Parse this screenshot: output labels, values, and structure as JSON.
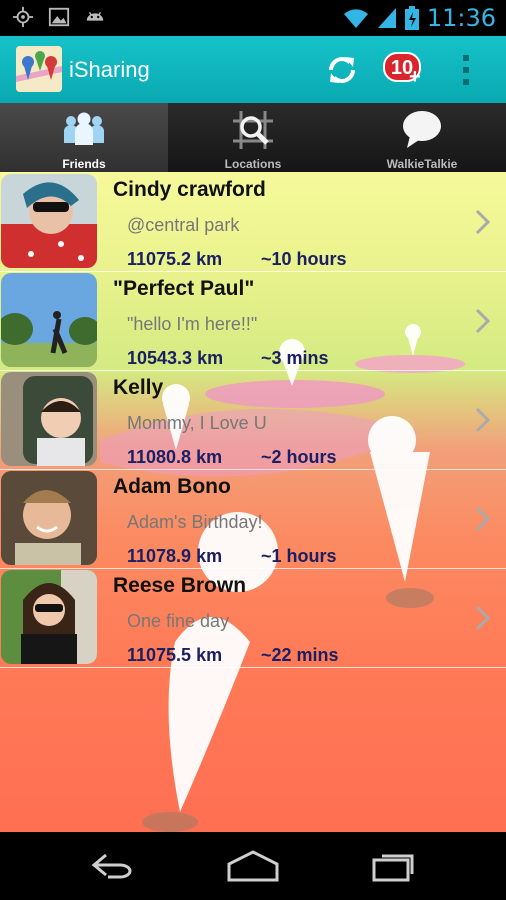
{
  "status_bar": {
    "time": "11:36",
    "icons": [
      "gps-icon",
      "image-icon",
      "android-icon",
      "wifi-icon",
      "signal-icon",
      "battery-icon"
    ]
  },
  "app_bar": {
    "title": "iSharing",
    "notification_count": "10",
    "notification_plus": "+",
    "icons": [
      "app-logo-icon",
      "refresh-icon",
      "overflow-menu-icon"
    ]
  },
  "tabs": [
    {
      "label": "Friends",
      "icon": "friends-icon",
      "active": true
    },
    {
      "label": "Locations",
      "icon": "locations-icon",
      "active": false
    },
    {
      "label": "WalkieTalkie",
      "icon": "chat-bubble-icon",
      "active": false
    }
  ],
  "friends": [
    {
      "name": "Cindy crawford",
      "status": "@central park",
      "distance": "11075.2 km",
      "time": "~10 hours"
    },
    {
      "name": "\"Perfect Paul\"",
      "status": "\"hello I'm here!!\"",
      "distance": "10543.3 km",
      "time": "~3 mins"
    },
    {
      "name": "Kelly",
      "status": "Mommy, I Love U",
      "distance": "11080.8 km",
      "time": "~2 hours"
    },
    {
      "name": "Adam Bono",
      "status": "Adam's Birthday!",
      "distance": "11078.9 km",
      "time": "~1 hours"
    },
    {
      "name": "Reese Brown",
      "status": "One fine day",
      "distance": "11075.5 km",
      "time": "~22 mins"
    }
  ],
  "nav_bar": {
    "icons": [
      "back-icon",
      "home-icon",
      "recent-apps-icon"
    ]
  },
  "colors": {
    "accent": "#0aa9b1",
    "distance_text": "#1a2063",
    "badge": "#d9252b",
    "status_bar_icons": "#33b5e5"
  }
}
